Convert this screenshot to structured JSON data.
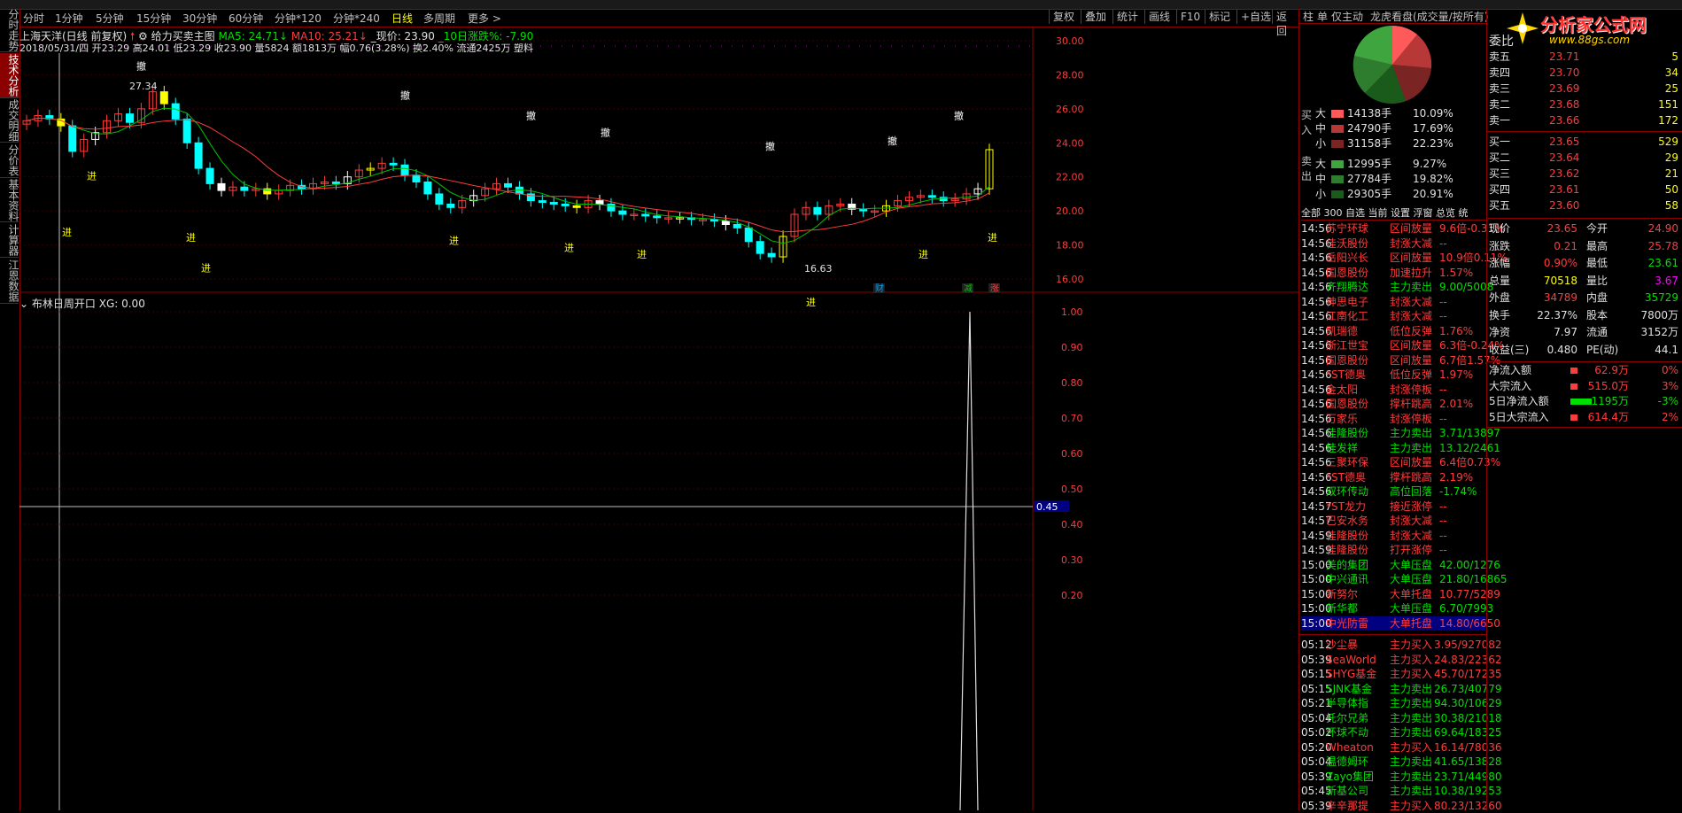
{
  "tabs_left": [
    "分时走势",
    "技术分析",
    "成交明细",
    "分价表",
    "基本资料",
    "计算器",
    "江恩数据"
  ],
  "periods": [
    "分时",
    "1分钟",
    "5分钟",
    "15分钟",
    "30分钟",
    "60分钟",
    "分钟*120",
    "分钟*240",
    "日线",
    "多周期",
    "更多 >"
  ],
  "active_period": "日线",
  "toolbar": [
    "复权",
    "叠加",
    "统计",
    "画线",
    "F10",
    "标记",
    "+自选",
    "返回"
  ],
  "header": {
    "title": "上海天洋(日线 前复权)",
    "indicator": "给力买卖主图",
    "ma5": "MA5: 24.71",
    "ma10": "MA10: 25.21",
    "price": "_现价: 23.90",
    "change10": "_10日涨跌%: -7.90",
    "ohlc_line": "2018/05/31/四 开23.29 高24.01 低23.29 收23.90 量5824 额1813万 幅0.76(3.28%) 换2.40% 流通2425万 塑料"
  },
  "price_axis": [
    "30.00",
    "28.00",
    "26.00",
    "24.00",
    "22.00",
    "20.00",
    "18.00",
    "16.00"
  ],
  "annotations": {
    "high": "27.34",
    "low": "16.63",
    "buy": "进",
    "sell": "撤"
  },
  "sub_chart": {
    "title": "布林日周开口",
    "xg": "XG: 0.00",
    "axis": [
      "1.00",
      "0.90",
      "0.80",
      "0.70",
      "0.60",
      "0.50",
      "0.40",
      "0.30",
      "0.20"
    ],
    "cursor_value": "0.45"
  },
  "right_tabs": [
    "柱",
    "单",
    "仅主动",
    "龙虎看盘(成交量/按所有)"
  ],
  "flow": {
    "buy_label": "买入",
    "sell_label": "卖出",
    "buy": [
      [
        "大",
        "14138手",
        "10.09%"
      ],
      [
        "中",
        "24790手",
        "17.69%"
      ],
      [
        "小",
        "31158手",
        "22.23%"
      ]
    ],
    "sell": [
      [
        "大",
        "12995手",
        "9.27%"
      ],
      [
        "中",
        "27784手",
        "19.82%"
      ],
      [
        "小",
        "29305手",
        "20.91%"
      ]
    ]
  },
  "filter_tabs": [
    "全部",
    "300",
    "自选",
    "当前",
    "设置",
    "浮窗",
    "总览",
    "统"
  ],
  "ticker": [
    [
      "14:56",
      "苏宁环球",
      "区间放量",
      "9.6倍-0.31%"
    ],
    [
      "14:56",
      "佳沃股份",
      "封涨大减",
      "--"
    ],
    [
      "14:56",
      "岳阳兴长",
      "区间放量",
      "10.9倍0.11%"
    ],
    [
      "14:56",
      "国恩股份",
      "加速拉升",
      "1.57%"
    ],
    [
      "14:56",
      "齐翔腾达",
      "主力卖出",
      "9.00/5008"
    ],
    [
      "14:56",
      "神思电子",
      "封涨大减",
      "--"
    ],
    [
      "14:56",
      "江南化工",
      "封涨大减",
      "--"
    ],
    [
      "14:56",
      "凯瑞德",
      "低位反弹",
      "1.76%"
    ],
    [
      "14:56",
      "浙江世宝",
      "区间放量",
      "6.3倍-0.24%"
    ],
    [
      "14:56",
      "国恩股份",
      "区间放量",
      "6.7倍1.57%"
    ],
    [
      "14:56",
      "*ST德奥",
      "低位反弹",
      "1.97%"
    ],
    [
      "14:56",
      "金太阳",
      "封涨停板",
      "--"
    ],
    [
      "14:56",
      "国恩股份",
      "撑杆跳高",
      "2.01%"
    ],
    [
      "14:56",
      "万家乐",
      "封涨停板",
      "--"
    ],
    [
      "14:56",
      "佳隆股份",
      "主力卖出",
      "3.71/13897"
    ],
    [
      "14:56",
      "桂发祥",
      "主力卖出",
      "13.12/2461"
    ],
    [
      "14:56",
      "三聚环保",
      "区间放量",
      "6.4倍0.73%"
    ],
    [
      "14:56",
      "*ST德奥",
      "撑杆跳高",
      "2.19%"
    ],
    [
      "14:56",
      "双环传动",
      "高位回落",
      "-1.74%"
    ],
    [
      "14:57",
      "*ST龙力",
      "接近涨停",
      "--"
    ],
    [
      "14:57",
      "巴安水务",
      "封涨大减",
      "--"
    ],
    [
      "14:59",
      "佳隆股份",
      "封涨大减",
      "--"
    ],
    [
      "14:59",
      "佳隆股份",
      "打开涨停",
      "--"
    ],
    [
      "15:00",
      "美的集团",
      "大单压盘",
      "42.00/1276"
    ],
    [
      "15:00",
      "中兴通讯",
      "大单压盘",
      "21.80/16865"
    ],
    [
      "15:00",
      "新努尔",
      "大单托盘",
      "10.77/5289"
    ],
    [
      "15:00",
      "新华都",
      "大单压盘",
      "6.70/7993"
    ],
    [
      "15:00",
      "中光防雷",
      "大单托盘",
      "14.80/6650"
    ]
  ],
  "ticker2": [
    [
      "05:12",
      "沙尘暴",
      "主力买入",
      "3.95/927082"
    ],
    [
      "05:39",
      "SeaWorld",
      "主力买入",
      "24.83/22362"
    ],
    [
      "05:15",
      "SHYG基金",
      "主力买入",
      "45.70/17235"
    ],
    [
      "05:15",
      "SJNK基金",
      "主力卖出",
      "26.73/40779"
    ],
    [
      "05:21",
      "半导体指",
      "主力卖出",
      "94.30/10629"
    ],
    [
      "05:04",
      "托尔兄弟",
      "主力卖出",
      "30.38/21018"
    ],
    [
      "05:02",
      "环球不动",
      "主力卖出",
      "69.64/18325"
    ],
    [
      "05:20",
      "Wheaton",
      "主力买入",
      "16.14/78036"
    ],
    [
      "05:04",
      "温德姆环",
      "主力卖出",
      "41.65/13828"
    ],
    [
      "05:39",
      "Zayo集团",
      "主力卖出",
      "23.71/44980"
    ],
    [
      "05:45",
      "新基公司",
      "主力卖出",
      "10.38/19253"
    ],
    [
      "05:39",
      "辛辛那提",
      "主力买入",
      "80.23/13260"
    ]
  ],
  "orderbook": {
    "sells": [
      [
        "卖五",
        "23.71",
        "5"
      ],
      [
        "卖四",
        "23.70",
        "34"
      ],
      [
        "卖三",
        "23.69",
        "25"
      ],
      [
        "卖二",
        "23.68",
        "151"
      ],
      [
        "卖一",
        "23.66",
        "172"
      ]
    ],
    "buys": [
      [
        "买一",
        "23.65",
        "529"
      ],
      [
        "买二",
        "23.64",
        "29"
      ],
      [
        "买三",
        "23.62",
        "21"
      ],
      [
        "买四",
        "23.61",
        "50"
      ],
      [
        "买五",
        "23.60",
        "58"
      ]
    ]
  },
  "stats": [
    [
      "现价",
      "23.65",
      "今开",
      "24.90"
    ],
    [
      "涨跌",
      "0.21",
      "最高",
      "25.78"
    ],
    [
      "涨幅",
      "0.90%",
      "最低",
      "23.61"
    ],
    [
      "总量",
      "70518",
      "量比",
      "3.67"
    ],
    [
      "外盘",
      "34789",
      "内盘",
      "35729"
    ],
    [
      "换手",
      "22.37%",
      "股本",
      "7800万"
    ],
    [
      "净资",
      "7.97",
      "流通",
      "3152万"
    ],
    [
      "收益(三)",
      "0.480",
      "PE(动)",
      "44.1"
    ]
  ],
  "capital": [
    [
      "净流入额",
      "62.9万",
      "0%"
    ],
    [
      "大宗流入",
      "515.0万",
      "3%"
    ],
    [
      "5日净流入额",
      "-1195万",
      "-3%"
    ],
    [
      "5日大宗流入",
      "614.4万",
      "2%"
    ]
  ],
  "logo": {
    "text": "分析家公式网",
    "url_text": "www.88gs.com"
  },
  "bottom_tags": [
    "财",
    "减",
    "涨"
  ],
  "colors": {
    "up": "#ff3c3c",
    "down": "#00ffff",
    "ma5": "#00c000",
    "ma10": "#ff3c3c",
    "grid": "#8b0000"
  }
}
